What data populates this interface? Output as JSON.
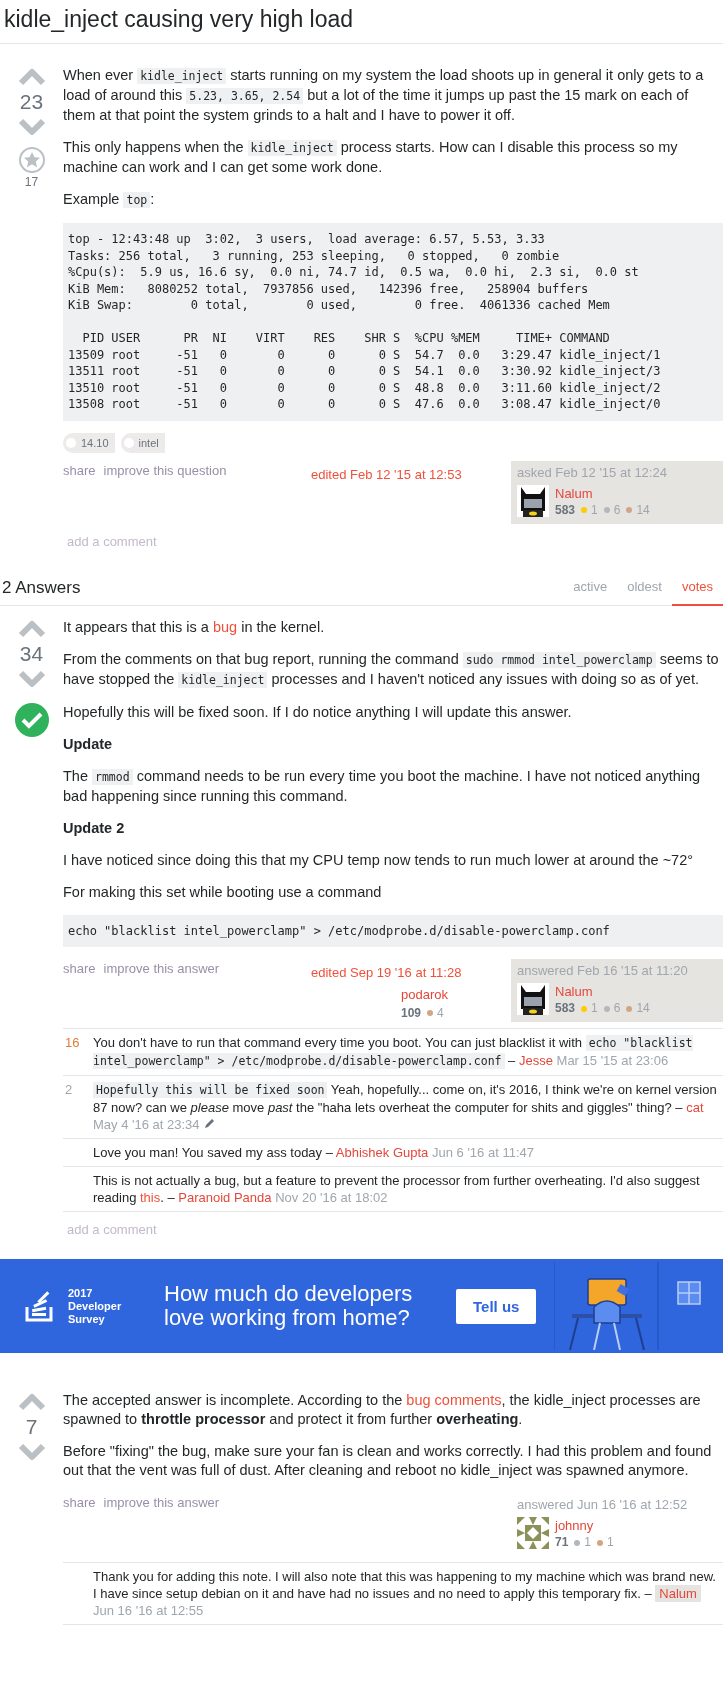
{
  "title": "kidle_inject causing very high load",
  "question": {
    "votes": "23",
    "favorites": "17",
    "body": [
      {
        "kind": "p",
        "segments": [
          {
            "kind": "text",
            "text": "When ever "
          },
          {
            "kind": "code",
            "text": "kidle_inject"
          },
          {
            "kind": "text",
            "text": " starts running on my system the load shoots up in general it only gets to a load of around this "
          },
          {
            "kind": "code",
            "text": "5.23, 3.65, 2.54"
          },
          {
            "kind": "text",
            "text": " but a lot of the time it jumps up past the 15 mark on each of them at that point the system grinds to a halt and I have to power it off."
          }
        ]
      },
      {
        "kind": "p",
        "segments": [
          {
            "kind": "text",
            "text": "This only happens when the "
          },
          {
            "kind": "code",
            "text": "kidle_inject"
          },
          {
            "kind": "text",
            "text": " process starts. How can I disable this process so my machine can work and I can get some work done."
          }
        ]
      },
      {
        "kind": "p",
        "segments": [
          {
            "kind": "text",
            "text": "Example "
          },
          {
            "kind": "code",
            "text": "top"
          },
          {
            "kind": "text",
            "text": ":"
          }
        ]
      },
      {
        "kind": "pre",
        "text": "top - 12:43:48 up  3:02,  3 users,  load average: 6.57, 5.53, 3.33\nTasks: 256 total,   3 running, 253 sleeping,   0 stopped,   0 zombie\n%Cpu(s):  5.9 us, 16.6 sy,  0.0 ni, 74.7 id,  0.5 wa,  0.0 hi,  2.3 si,  0.0 st\nKiB Mem:   8080252 total,  7937856 used,   142396 free,   258904 buffers\nKiB Swap:        0 total,        0 used,        0 free.  4061336 cached Mem\n\n  PID USER      PR  NI    VIRT    RES    SHR S  %CPU %MEM     TIME+ COMMAND\n13509 root     -51   0       0      0      0 S  54.7  0.0   3:29.47 kidle_inject/1\n13511 root     -51   0       0      0      0 S  54.1  0.0   3:30.92 kidle_inject/3\n13510 root     -51   0       0      0      0 S  48.8  0.0   3:11.60 kidle_inject/2\n13508 root     -51   0       0      0      0 S  47.6  0.0   3:08.47 kidle_inject/0"
      }
    ],
    "tags": [
      "14.10",
      "intel"
    ],
    "menu": [
      "share",
      "improve this question"
    ],
    "editor": {
      "label": "edited Feb 12 '15 at 12:53"
    },
    "owner": {
      "action": "asked Feb 12 '15 at 12:24",
      "name": "Nalum",
      "rep": "583",
      "highlighted": true,
      "avatar": {
        "kind": "mask"
      },
      "badges": [
        {
          "color": "#ffcc01",
          "count": "1"
        },
        {
          "color": "#b4b8bc",
          "count": "6"
        },
        {
          "color": "#d1a684",
          "count": "14"
        }
      ]
    },
    "add_comment": "add a comment"
  },
  "answers_header": {
    "title": "2 Answers",
    "tabs": [
      {
        "label": "active",
        "selected": false
      },
      {
        "label": "oldest",
        "selected": false
      },
      {
        "label": "votes",
        "selected": true
      }
    ]
  },
  "answers": [
    {
      "votes": "34",
      "accepted": true,
      "body": [
        {
          "kind": "p",
          "segments": [
            {
              "kind": "text",
              "text": "It appears that this is a "
            },
            {
              "kind": "link",
              "text": "bug"
            },
            {
              "kind": "text",
              "text": " in the kernel."
            }
          ]
        },
        {
          "kind": "p",
          "segments": [
            {
              "kind": "text",
              "text": "From the comments on that bug report, running the command "
            },
            {
              "kind": "code",
              "text": "sudo rmmod intel_powerclamp"
            },
            {
              "kind": "text",
              "text": " seems to have stopped the "
            },
            {
              "kind": "code",
              "text": "kidle_inject"
            },
            {
              "kind": "text",
              "text": " processes and I haven't noticed any issues with doing so as of yet."
            }
          ]
        },
        {
          "kind": "p",
          "segments": [
            {
              "kind": "text",
              "text": "Hopefully this will be fixed soon. If I do notice anything I will update this answer."
            }
          ]
        },
        {
          "kind": "h",
          "text": "Update"
        },
        {
          "kind": "p",
          "segments": [
            {
              "kind": "text",
              "text": "The "
            },
            {
              "kind": "code",
              "text": "rmmod"
            },
            {
              "kind": "text",
              "text": " command needs to be run every time you boot the machine. I have not noticed anything bad happening since running this command."
            }
          ]
        },
        {
          "kind": "h",
          "text": "Update 2"
        },
        {
          "kind": "p",
          "segments": [
            {
              "kind": "text",
              "text": "I have noticed since doing this that my CPU temp now tends to run much lower at around the ~72°"
            }
          ]
        },
        {
          "kind": "p",
          "segments": [
            {
              "kind": "text",
              "text": "For making this set while booting use a command"
            }
          ]
        },
        {
          "kind": "pre",
          "text": "echo \"blacklist intel_powerclamp\" > /etc/modprobe.d/disable-powerclamp.conf"
        }
      ],
      "menu": [
        "share",
        "improve this answer"
      ],
      "editor": {
        "label": "edited Sep 19 '16 at 11:28",
        "name": "podarok",
        "rep": "109",
        "badges": [
          {
            "color": "#d1a684",
            "count": "4"
          }
        ]
      },
      "owner": {
        "action": "answered Feb 16 '15 at 11:20",
        "name": "Nalum",
        "rep": "583",
        "highlighted": true,
        "avatar": {
          "kind": "mask"
        },
        "badges": [
          {
            "color": "#ffcc01",
            "count": "1"
          },
          {
            "color": "#b4b8bc",
            "count": "6"
          },
          {
            "color": "#d1a684",
            "count": "14"
          }
        ]
      },
      "comments": [
        {
          "score": "16",
          "hot": true,
          "segments": [
            {
              "kind": "text",
              "text": "You don't have to run that command every time you boot. You can just blacklist it with "
            },
            {
              "kind": "code",
              "text": "echo \"blacklist intel_powerclamp\" > /etc/modprobe.d/disable-powerclamp.conf"
            },
            {
              "kind": "text",
              "text": " – "
            }
          ],
          "author": "Jesse",
          "author_is_op": false,
          "date": "Mar 15 '15 at 23:06",
          "edited": false
        },
        {
          "score": "2",
          "hot": false,
          "segments": [
            {
              "kind": "code",
              "text": "Hopefully this will be fixed soon"
            },
            {
              "kind": "text",
              "text": " Yeah, hopefully... come on, it's 2016, I think we're on kernel version 87 now? can we "
            },
            {
              "kind": "italic",
              "text": "please"
            },
            {
              "kind": "text",
              "text": " move "
            },
            {
              "kind": "italic",
              "text": "past"
            },
            {
              "kind": "text",
              "text": " the \"haha lets overheat the computer for shits and giggles\" thing? – "
            }
          ],
          "author": "cat",
          "author_is_op": false,
          "date": "May 4 '16 at 23:34",
          "edited": true
        },
        {
          "segments": [
            {
              "kind": "text",
              "text": "Love you man! You saved my ass today – "
            }
          ],
          "author": "Abhishek Gupta",
          "author_is_op": false,
          "date": "Jun 6 '16 at 11:47",
          "edited": false
        },
        {
          "segments": [
            {
              "kind": "text",
              "text": "This is not actually a bug, but a feature to prevent the processor from further overheating. I'd also suggest reading "
            },
            {
              "kind": "link",
              "text": "this"
            },
            {
              "kind": "text",
              "text": ". – "
            }
          ],
          "author": "Paranoid Panda",
          "author_is_op": false,
          "date": "Nov 20 '16 at 18:02",
          "edited": false
        }
      ],
      "add_comment": "add a comment"
    },
    {
      "votes": "7",
      "accepted": false,
      "body": [
        {
          "kind": "p",
          "segments": [
            {
              "kind": "text",
              "text": "The accepted answer is incomplete. According to the "
            },
            {
              "kind": "link",
              "text": "bug comments"
            },
            {
              "kind": "text",
              "text": ", the kidle_inject processes are spawned to "
            },
            {
              "kind": "bold",
              "text": "throttle processor"
            },
            {
              "kind": "text",
              "text": " and protect it from further "
            },
            {
              "kind": "bold",
              "text": "overheating"
            },
            {
              "kind": "text",
              "text": "."
            }
          ]
        },
        {
          "kind": "p",
          "segments": [
            {
              "kind": "text",
              "text": "Before \"fixing\" the bug, make sure your fan is clean and works correctly. I had this problem and found out that the vent was full of dust. After cleaning and reboot no kidle_inject was spawned anymore."
            }
          ]
        }
      ],
      "menu": [
        "share",
        "improve this answer"
      ],
      "owner": {
        "action": "answered Jun 16 '16 at 12:52",
        "name": "johnny",
        "rep": "71",
        "highlighted": false,
        "avatar": {
          "kind": "pattern"
        },
        "badges": [
          {
            "color": "#b4b8bc",
            "count": "1"
          },
          {
            "color": "#d1a684",
            "count": "1"
          }
        ]
      },
      "comments": [
        {
          "segments": [
            {
              "kind": "text",
              "text": "Thank you for adding this note. I will also note that this was happening to my machine which was brand new. I have since setup debian on it and have had no issues and no need to apply this temporary fix. – "
            }
          ],
          "author": "Nalum",
          "author_is_op": true,
          "date": "Jun 16 '16 at 12:55",
          "edited": false
        }
      ]
    }
  ],
  "banner": {
    "logo_lines": [
      "2017",
      "Developer",
      "Survey"
    ],
    "headline": "How much do developers love working from home?",
    "button": "Tell us"
  }
}
